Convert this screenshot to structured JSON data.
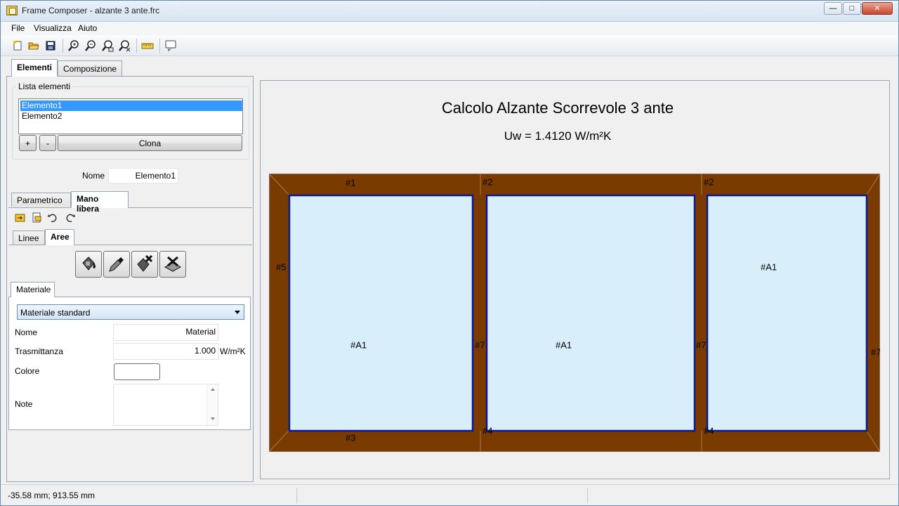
{
  "window": {
    "title": "Frame Composer - alzante 3 ante.frc"
  },
  "menu": [
    "File",
    "Visualizza",
    "Aiuto"
  ],
  "toolbar_icons": [
    "new-file-icon",
    "open-folder-icon",
    "save-icon",
    "zoom-in-icon",
    "zoom-out-icon",
    "zoom-fit-icon",
    "zoom-reset-icon",
    "ruler-icon",
    "comment-icon"
  ],
  "main_tabs": [
    "Elementi",
    "Composizione"
  ],
  "lista": {
    "legend": "Lista elementi",
    "items": [
      "Elemento1",
      "Elemento2"
    ],
    "add_label": "+",
    "remove_label": "-",
    "clone_label": "Clona"
  },
  "nome_row": {
    "label": "Nome",
    "value": "Elemento1"
  },
  "mode_tabs": [
    "Parametrico",
    "Mano libera"
  ],
  "edit_icons": [
    "import-icon",
    "export-icon",
    "undo-icon",
    "redo-icon"
  ],
  "draw_tabs": [
    "Linee",
    "Aree"
  ],
  "area_tools": [
    "fill-bucket-icon",
    "eyedropper-icon",
    "fill-remove-icon",
    "clear-all-icon"
  ],
  "materiale": {
    "tab": "Materiale",
    "combo_value": "Materiale standard",
    "nome_label": "Nome",
    "nome_value": "Material",
    "trasm_label": "Trasmittanza",
    "trasm_value": "1.000",
    "trasm_unit": "W/m²K",
    "colore_label": "Colore",
    "note_label": "Note"
  },
  "canvas": {
    "title": "Calcolo Alzante Scorrevole 3 ante",
    "uw": "Uw = 1.4120 W/m²K",
    "labels": {
      "l1": "#1",
      "l2a": "#2",
      "l2b": "#2",
      "l3": "#3",
      "l4a": "#4",
      "l4b": "#4",
      "l5": "#5",
      "l7a": "#7",
      "l7b": "#7",
      "l7c": "#7",
      "a1": "#A1",
      "a2": "#A1",
      "a3": "#A1"
    },
    "colors": {
      "frame": "#7a3b00",
      "glass": "#d8eefb",
      "glass_border": "#0a1a8c"
    }
  },
  "status": {
    "coords": "-35.58 mm; 913.55 mm"
  }
}
